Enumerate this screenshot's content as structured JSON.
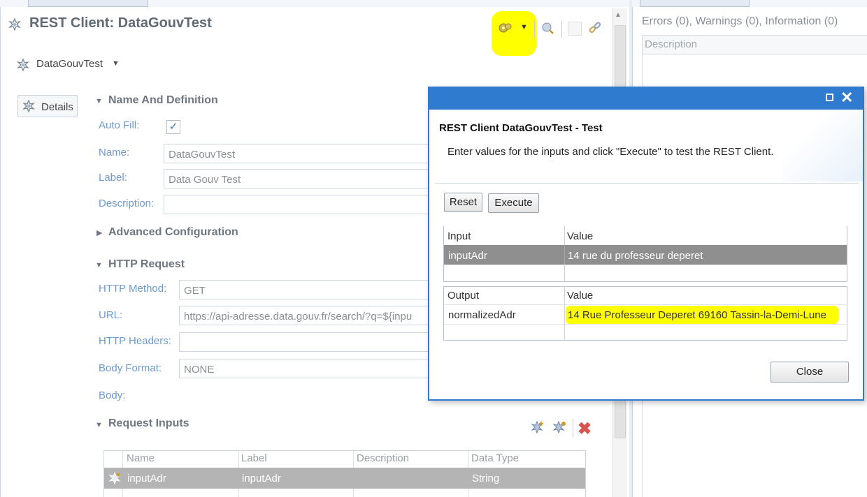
{
  "editor": {
    "title": "REST Client: DataGouvTest",
    "combo_value": "DataGouvTest",
    "details_tab": "Details",
    "section_name": "Name And Definition",
    "auto_fill_label": "Auto Fill:",
    "auto_fill_checked": true,
    "name_label": "Name:",
    "name_value": "DataGouvTest",
    "label_label": "Label:",
    "label_value": "Data Gouv Test",
    "description_label": "Description:",
    "description_value": "",
    "section_advanced": "Advanced Configuration",
    "section_http": "HTTP Request",
    "http_method_label": "HTTP Method:",
    "http_method_value": "GET",
    "url_label": "URL:",
    "url_value": "https://api-adresse.data.gouv.fr/search/?q=${inpu",
    "http_headers_label": "HTTP Headers:",
    "http_headers_value": "",
    "body_format_label": "Body Format:",
    "body_format_value": "NONE",
    "body_label": "Body:",
    "section_request_inputs": "Request Inputs",
    "request_inputs": {
      "columns": [
        "Name",
        "Label",
        "Description",
        "Data Type"
      ],
      "rows": [
        {
          "name": "inputAdr",
          "label": "inputAdr",
          "description": "",
          "data_type": "String"
        }
      ]
    }
  },
  "problems": {
    "status": "Errors (0), Warnings (0), Information (0)",
    "column_description": "Description"
  },
  "dialog": {
    "title": "REST Client DataGouvTest - Test",
    "message": "Enter values for the inputs and click \"Execute\" to test the REST Client.",
    "reset_label": "Reset",
    "execute_label": "Execute",
    "close_label": "Close",
    "input_table": {
      "col_input": "Input",
      "col_value": "Value",
      "rows": [
        {
          "input": "inputAdr",
          "value": "14 rue du professeur deperet"
        }
      ]
    },
    "output_table": {
      "col_output": "Output",
      "col_value": "Value",
      "rows": [
        {
          "output": "normalizedAdr",
          "value": "14 Rue Professeur Deperet 69160 Tassin-la-Demi-Lune"
        }
      ]
    }
  },
  "icons": {
    "editor_icon": "rest-client-icon",
    "toolbar_test": "test-gear-icon",
    "toolbar_dropdown": "chevron-down-icon",
    "toolbar_refresh": "refresh-icon",
    "toolbar_blank": "disabled-icon",
    "toolbar_link": "link-icon",
    "add_input": "add-input-icon",
    "delete": "delete-icon"
  },
  "colors": {
    "dialog_blue": "#2e7bd0",
    "highlight_yellow": "#ffff00",
    "label_blue": "#6d9ad0",
    "selected_row_gray": "#8f8f8f"
  }
}
